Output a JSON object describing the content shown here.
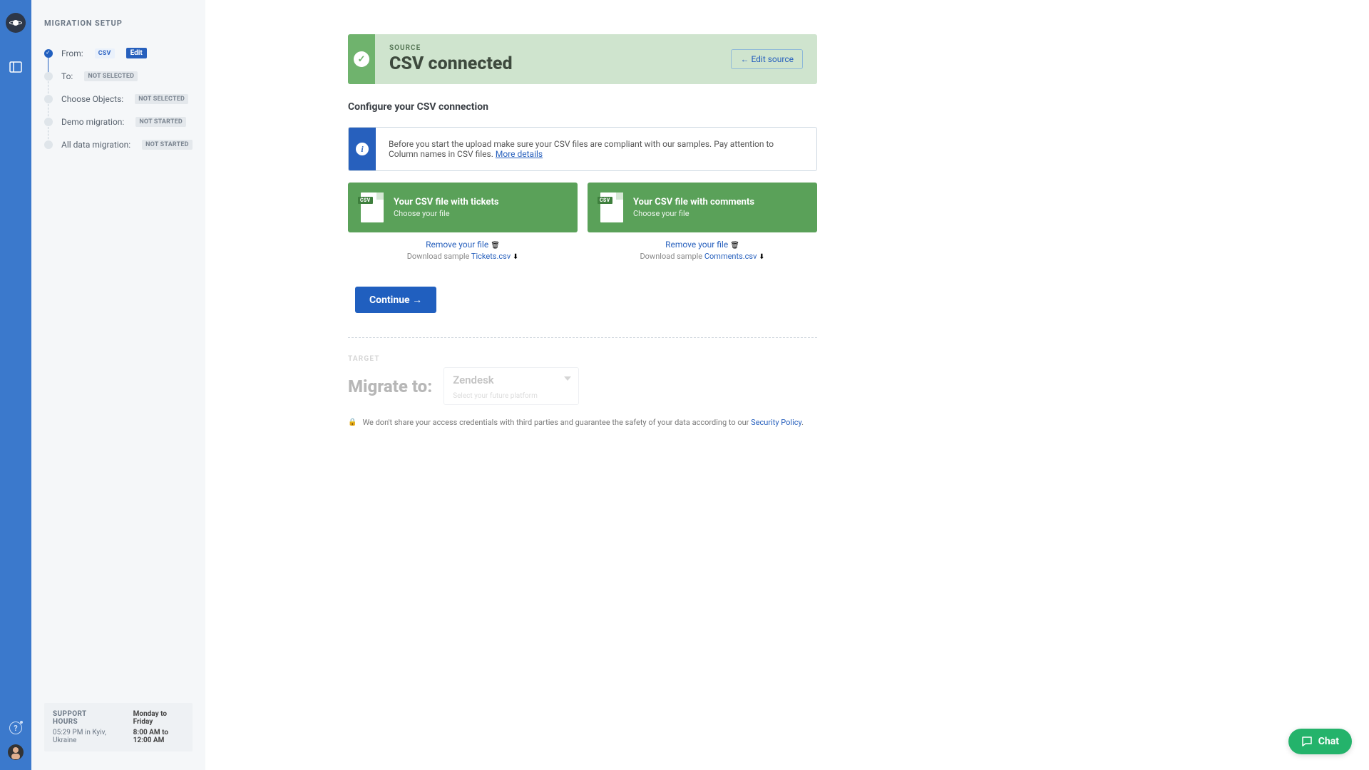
{
  "sidebar": {
    "title": "MIGRATION SETUP",
    "steps": [
      {
        "label": "From:",
        "chip": "CSV",
        "edit": "Edit"
      },
      {
        "label": "To:",
        "chip": "NOT SELECTED"
      },
      {
        "label": "Choose Objects:",
        "chip": "NOT SELECTED"
      },
      {
        "label": "Demo migration:",
        "chip": "NOT STARTED"
      },
      {
        "label": "All data migration:",
        "chip": "NOT STARTED"
      }
    ],
    "support": {
      "heading": "SUPPORT HOURS",
      "time": "05:29 PM in Kyiv, Ukraine",
      "days": "Monday to Friday",
      "hours": "8:00 AM to 12:00 AM"
    }
  },
  "banner": {
    "eyebrow": "SOURCE",
    "title": "CSV connected",
    "edit": "← Edit source"
  },
  "section": {
    "title": "Configure your CSV connection"
  },
  "info": {
    "text": "Before you start the upload make sure your CSV files are compliant with our samples. Pay attention to Column names in CSV files. ",
    "link": "More details"
  },
  "cards": [
    {
      "title": "Your CSV file with tickets",
      "sub": "Choose your file",
      "remove": "Remove your file",
      "sample_prefix": "Download sample ",
      "sample": "Tickets.csv",
      "badge": "CSV"
    },
    {
      "title": "Your CSV file with comments",
      "sub": "Choose your file",
      "remove": "Remove your file",
      "sample_prefix": "Download sample ",
      "sample": "Comments.csv",
      "badge": "CSV"
    }
  ],
  "continue": "Continue →",
  "target": {
    "eyebrow": "TARGET",
    "label": "Migrate to:",
    "value": "Zendesk",
    "hint": "Select your future platform"
  },
  "policy": {
    "text": "We don't share your access credentials with third parties and guarantee the safety of your data according to our ",
    "link": "Security Policy"
  },
  "chat": "Chat"
}
